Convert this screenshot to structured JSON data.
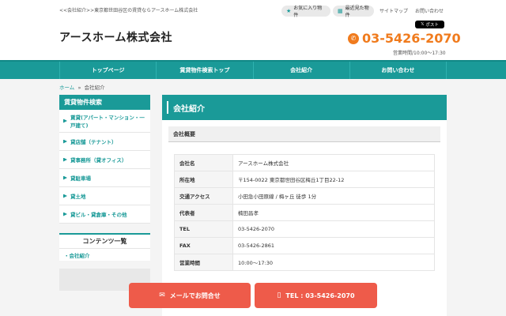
{
  "header": {
    "breadcrumb_text": "<<会社紹介>>東京都世田谷区の賃貸ならアースホーム株式会社",
    "favorites_label": "お気に入り物件",
    "recent_label": "最近見た物件",
    "sitemap_label": "サイトマップ",
    "contact_label": "お問い合わせ",
    "company_name": "アースホーム株式会社",
    "post_label": "ポスト",
    "post_logo": "𝕏",
    "phone": "03-5426-2070",
    "hours": "営業時間/10:00～17:30"
  },
  "nav": {
    "items": [
      "トップページ",
      "賃貸物件検索トップ",
      "会社紹介",
      "お問い合わせ"
    ]
  },
  "crumb": {
    "home": "ホーム",
    "separator": "»",
    "current": "会社紹介"
  },
  "sidebar": {
    "search_title": "賃貸物件検索",
    "items": [
      "賃貸(アパート・マンション・一戸建て)",
      "貸店舗（テナント）",
      "貸事務所（貸オフィス）",
      "貸駐車場",
      "貸土地",
      "貸ビル・貸倉庫・その他"
    ],
    "contents_title": "コンテンツ一覧",
    "contents_items": [
      "会社紹介"
    ]
  },
  "main": {
    "title": "会社紹介",
    "section_title": "会社概要",
    "rows": [
      {
        "k": "会社名",
        "v": "アースホーム株式会社"
      },
      {
        "k": "所在地",
        "v": "〒154-0022 東京都世田谷区梅丘1丁目22-12"
      },
      {
        "k": "交通アクセス",
        "v": "小田急小田原線 / 梅ヶ丘 徒歩 1分"
      },
      {
        "k": "代表者",
        "v": "楠田昌孝"
      },
      {
        "k": "TEL",
        "v": "03-5426-2070"
      },
      {
        "k": "FAX",
        "v": "03-5426-2861"
      },
      {
        "k": "営業時間",
        "v": "10:00～17:30"
      }
    ]
  },
  "footer_buttons": {
    "mail_label": "メールでお問合せ",
    "tel_label": "TEL : 03-5426-2070"
  },
  "colors": {
    "accent": "#1a9a98",
    "phone": "#f07b1d",
    "cta": "#ee5b4a"
  }
}
